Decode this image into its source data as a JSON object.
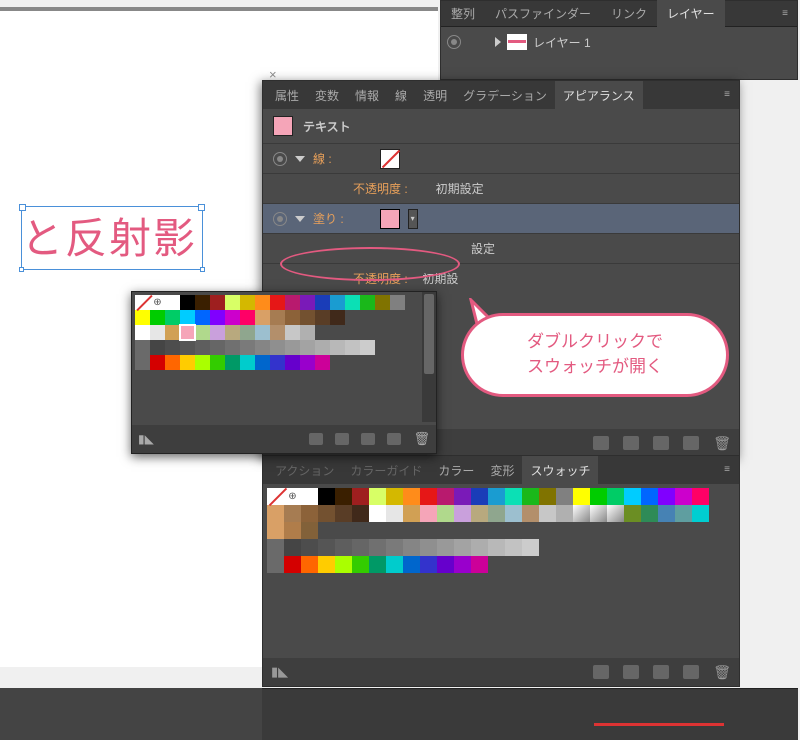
{
  "canvas": {
    "text": "と反射影"
  },
  "layers_palette": {
    "tabs": [
      "整列",
      "パスファインダー",
      "リンク",
      "レイヤー"
    ],
    "active_tab": 3,
    "layer_name": "レイヤー 1"
  },
  "appearance": {
    "tabs": [
      "属性",
      "変数",
      "情報",
      "線",
      "透明",
      "グラデーション",
      "アピアランス"
    ],
    "active_tab": 6,
    "object_label": "テキスト",
    "stroke_label": "線 :",
    "fill_label": "塗り :",
    "opacity_label": "不透明度 :",
    "opacity_value": "初期設定",
    "opacity_label2": "不透明度 :",
    "opacity_value2": "初期設定",
    "fill_color": "#f5a5b8"
  },
  "callout": {
    "line1": "ダブルクリックで",
    "line2": "スウォッチが開く"
  },
  "swatch_popup": {
    "rows": [
      [
        "none",
        "reg",
        "#ffffff",
        "#000000",
        "#3a1f00",
        "#9e1f1f",
        "#d8ff66",
        "#d4b800",
        "#ff8c1a",
        "#e61717",
        "#b81a6e",
        "#7a1ab8",
        "#1a3db8",
        "#1a9cd1",
        "#0be0b5",
        "#1ab81a",
        "#807300",
        "#808080"
      ],
      [
        "#ffff00",
        "#00cc00",
        "#00cc66",
        "#00ccff",
        "#0066ff",
        "#8000ff",
        "#cc00cc",
        "#ff0066",
        "#d9a066",
        "#a67c52",
        "#8c6239",
        "#735130",
        "#593d26",
        "#40291a"
      ],
      [
        "#ffffff",
        "#e6e6e6",
        "#d1a054",
        "#f5a5b8_sel",
        "#b0d98c",
        "#c9a0dc",
        "#b8a97e",
        "#8fa68e",
        "#9cbfcf",
        "#b38f6b",
        "#c7c7c7",
        "#b0b0b0"
      ],
      [
        "folder",
        "#454545",
        "#4d4d4d",
        "#555555",
        "#5e5e5e",
        "#666666",
        "#707070",
        "#7a7a7a",
        "#858585",
        "#8f8f8f",
        "#999999",
        "#a3a3a3",
        "#adadad",
        "#b8b8b8",
        "#c2c2c2",
        "#cccccc"
      ],
      [
        "folder",
        "#d40000",
        "#ff6600",
        "#ffcc00",
        "#aaff00",
        "#33cc00",
        "#009966",
        "#00cccc",
        "#0066cc",
        "#3333cc",
        "#6600cc",
        "#9900cc",
        "#cc0099"
      ]
    ]
  },
  "swatch_panel": {
    "tabs_left": [
      "アクション",
      "カラーガイド"
    ],
    "tabs": [
      "カラー",
      "変形",
      "スウォッチ"
    ],
    "active_tab": 2,
    "rows": [
      [
        "none",
        "reg",
        "#ffffff",
        "#000000",
        "#3a1f00",
        "#9e1f1f",
        "#d8ff66",
        "#d4b800",
        "#ff8c1a",
        "#e61717",
        "#b81a6e",
        "#7a1ab8",
        "#1a3db8",
        "#1a9cd1",
        "#0be0b5",
        "#1ab81a",
        "#807300",
        "#808080",
        "#ffff00",
        "#00cc00",
        "#00cc66",
        "#00ccff",
        "#0066ff",
        "#8000ff",
        "#cc00cc",
        "#ff0066"
      ],
      [
        "#d9a066",
        "#a67c52",
        "#8c6239",
        "#735130",
        "#593d26",
        "#40291a",
        "#ffffff",
        "#e6e6e6",
        "#d1a054",
        "#f5a5b8_sel",
        "#b0d98c",
        "#c9a0dc",
        "#b8a97e",
        "#8fa68e",
        "#9cbfcf",
        "#b38f6b",
        "#c7c7c7",
        "#b0b0b0",
        "grad1",
        "grad2",
        "grad3",
        "#6b8e23",
        "#2e8b57",
        "#4682b4",
        "#5f9ea0",
        "#00ced1"
      ],
      [
        "#d9a066",
        "#b07d4a",
        "#826139"
      ],
      [
        "folder",
        "#454545",
        "#4d4d4d",
        "#555555",
        "#5e5e5e",
        "#666666",
        "#707070",
        "#7a7a7a",
        "#858585",
        "#8f8f8f",
        "#999999",
        "#a3a3a3",
        "#adadad",
        "#b8b8b8",
        "#c2c2c2",
        "#cccccc"
      ],
      [
        "folder",
        "#d40000",
        "#ff6600",
        "#ffcc00",
        "#aaff00",
        "#33cc00",
        "#009966",
        "#00cccc",
        "#0066cc",
        "#3333cc",
        "#6600cc",
        "#9900cc",
        "#cc0099"
      ]
    ]
  }
}
